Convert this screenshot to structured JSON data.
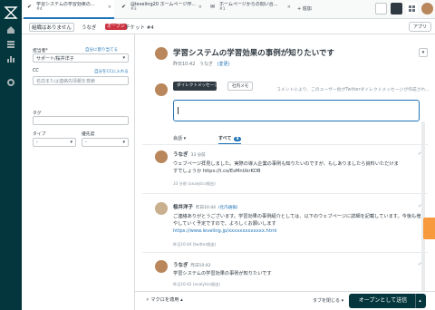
{
  "tabs": [
    {
      "title": "学習システムの学習効果の...",
      "sub": "#4",
      "active": true
    },
    {
      "title": "@leveling20 ホームページ作...",
      "sub": "#3",
      "active": false
    },
    {
      "title": "ホームページからの問い合...",
      "sub": "#1",
      "active": false
    }
  ],
  "add_tab_label": "+ 追加",
  "subheader": {
    "crumb_org": "組織はありません",
    "crumb_user": "うなぎ",
    "badge": "オープン",
    "ticket": "チケット #4",
    "apply_label": "アプリ"
  },
  "sidebar": {
    "assignee_label": "担当者*",
    "assignee_link": "自分に割り当てる",
    "assignee_value": "サポート/桜井洋子",
    "cc_label": "CC",
    "cc_link": "自分をCCに入れる",
    "cc_placeholder": "名前または連絡先情報を検索",
    "tags_label": "タグ",
    "type_label": "タイプ",
    "type_value": "-",
    "priority_label": "優先度",
    "priority_value": "-"
  },
  "ticket": {
    "title": "学習システムの学習効果の事例が知りたいです",
    "meta_time": "昨日10:42",
    "meta_user": "うなぎ",
    "meta_change": "(変更)"
  },
  "reply": {
    "channel_label": "ダイレクトメッセージ",
    "memo_label": "社内メモ",
    "hint": "コメントにより、このユーザー他がTwitterダイレクトメッセージが作成され..."
  },
  "filters": {
    "conversations": "会話",
    "all": "すべて",
    "count": "4"
  },
  "comments": [
    {
      "name": "うなぎ",
      "time": "33 分前",
      "line1": "ウェブページ拝見しました。実際の導入企業の事例も知りたいのですが、もしありましたら資料いただけま",
      "line2": "すでしょうか https://t.co/EsMnUkrKDB",
      "sub": "33 分前 (analytics経由)"
    },
    {
      "name": "桜井洋子",
      "time": "昨日10:44",
      "tag": "(社内通報)",
      "line1": "ご連絡ありがとうございます。学習効果の事例紹介としては、以下のウェブページに詳細を記載しています。今後も増やしていく予定ですので、よろしくお願いします",
      "link": "https://www.leveling.jp/xxxxxxxxxxxxx.html",
      "sub": "昨日10:44 (twitter経由)"
    },
    {
      "name": "うなぎ",
      "time": "昨日10:42",
      "line1": "学習システムの学習効果の事例が知りたいです",
      "sub": "昨日10:42 (analytics経由)"
    }
  ],
  "footer": {
    "macro": "マクロを適用",
    "close_tab": "タブを閉じる",
    "submit": "オープンとして送信"
  },
  "colors": {
    "rail": "#03363d",
    "accent": "#1f73b7",
    "open_badge": "#cc3340",
    "side_tab": "#f79a3e"
  }
}
